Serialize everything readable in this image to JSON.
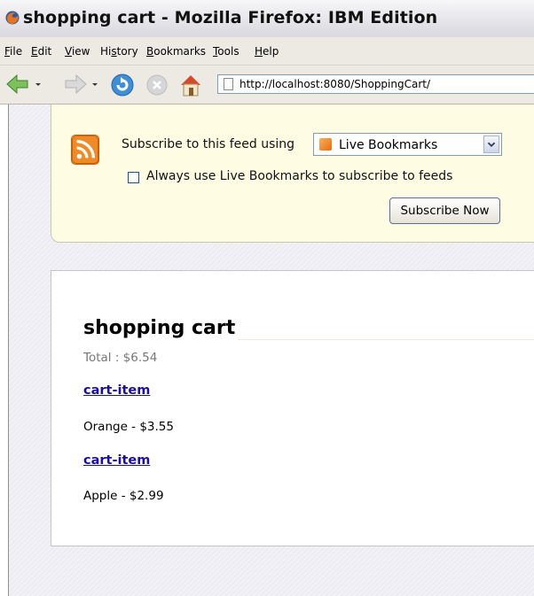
{
  "window": {
    "title": "shopping cart - Mozilla Firefox: IBM Edition"
  },
  "menu": [
    {
      "pre": "",
      "key": "F",
      "post": "ile"
    },
    {
      "pre": "",
      "key": "E",
      "post": "dit"
    },
    {
      "pre": "",
      "key": "V",
      "post": "iew"
    },
    {
      "pre": "Hi",
      "key": "s",
      "post": "tory"
    },
    {
      "pre": "",
      "key": "B",
      "post": "ookmarks"
    },
    {
      "pre": "",
      "key": "T",
      "post": "ools"
    },
    {
      "pre": "",
      "key": "H",
      "post": "elp"
    }
  ],
  "navbar": {
    "url": "http://localhost:8080/ShoppingCart/"
  },
  "feed": {
    "subscribe_label": "Subscribe to this feed using",
    "reader": "Live Bookmarks",
    "always_label": "Always use Live Bookmarks to subscribe to feeds",
    "always_checked": false,
    "button": "Subscribe Now"
  },
  "cart": {
    "title": "shopping cart",
    "total": "Total : $6.54",
    "items": [
      {
        "link": "cart-item",
        "desc": "Orange - $3.55"
      },
      {
        "link": "cart-item",
        "desc": "Apple - $2.99"
      }
    ]
  },
  "colors": {
    "feed_bg": "#fefde4",
    "link": "#1a0dab",
    "rss_orange": "#f08a24"
  }
}
